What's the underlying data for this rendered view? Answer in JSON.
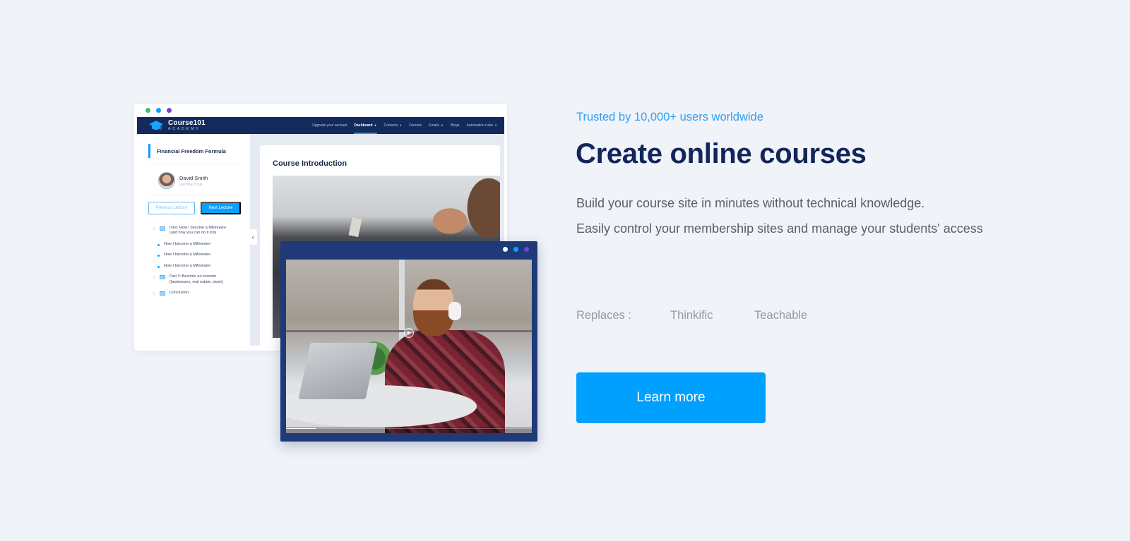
{
  "mockup": {
    "window_dots": [
      "#33c06a",
      "#0aa0ff",
      "#7a3fd6"
    ],
    "brand": {
      "title": "Course101",
      "subtitle": "ACADEMY"
    },
    "nav": [
      {
        "label": "Upgrade your account",
        "caret": false,
        "active": false
      },
      {
        "label": "Dashboard",
        "caret": true,
        "active": true
      },
      {
        "label": "Contacts",
        "caret": true,
        "active": false
      },
      {
        "label": "Funnels",
        "caret": false,
        "active": false
      },
      {
        "label": "Emails",
        "caret": true,
        "active": false
      },
      {
        "label": "Blogs",
        "caret": false,
        "active": false
      },
      {
        "label": "Automation rules",
        "caret": true,
        "active": false
      }
    ],
    "sidebar": {
      "course_title": "Financial Freedom Formula",
      "instructor_name": "David Smith",
      "instructor_role": "INSTRUCTOR",
      "prev_label": "Previous Lecture",
      "next_label": "Next Lecture",
      "lessons": [
        {
          "type": "section",
          "line1": "Intro: How I become a Millionaire",
          "line2": "(and how you can do it too)"
        },
        {
          "type": "sub",
          "line1": "How I become a Millionaire"
        },
        {
          "type": "sub",
          "line1": "How I become a Millionaire"
        },
        {
          "type": "sub",
          "line1": "How I become a Millionaire"
        },
        {
          "type": "section",
          "line1": "Part 3: Become an investor",
          "line2": "(businesses, real estate, stock)"
        },
        {
          "type": "section",
          "line1": "Conclusion"
        }
      ],
      "collapse_glyph": "‹"
    },
    "main": {
      "card_title": "Course Introduction"
    },
    "video_window": {
      "dots": [
        "#ffffff",
        "#0aa0ff",
        "#7a3fd6"
      ],
      "progress": 0.12
    }
  },
  "content": {
    "tagline": "Trusted by 10,000+ users worldwide",
    "headline": "Create online courses",
    "description_line1": "Build your course site in minutes without technical knowledge.",
    "description_line2": "Easily control your membership sites and manage your students' access",
    "replaces_label": "Replaces :",
    "replaces": [
      "Thinkific",
      "Teachable"
    ],
    "cta_label": "Learn more"
  },
  "colors": {
    "background": "#f0f3f8",
    "accent": "#00a0ff",
    "headline": "#13255a",
    "tagline": "#2ea0f5",
    "navbar": "#142a5c"
  }
}
